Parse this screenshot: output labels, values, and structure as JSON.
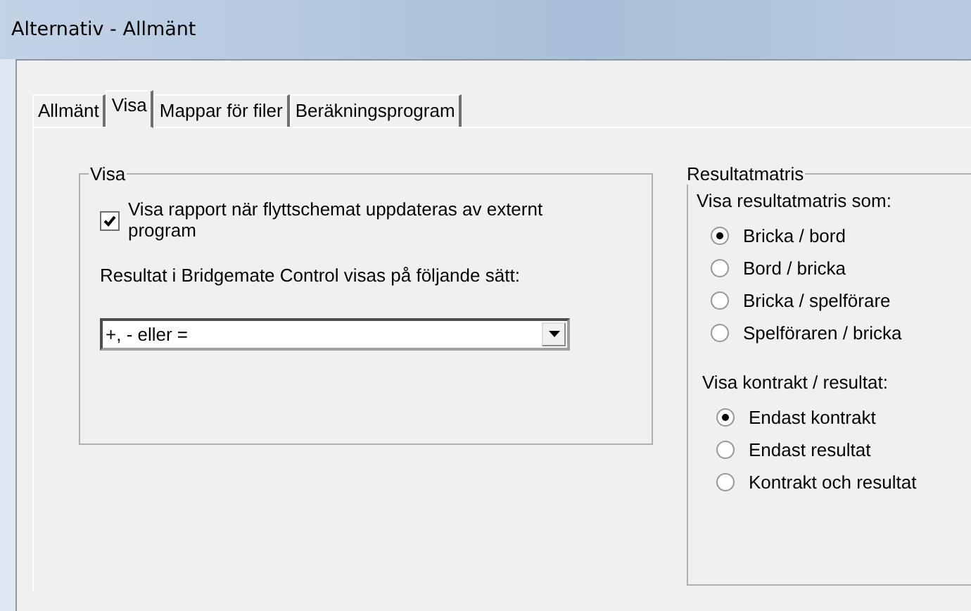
{
  "window": {
    "title": "Alternativ - Allmänt"
  },
  "tabs": [
    {
      "label": "Allmänt",
      "selected": false
    },
    {
      "label": "Visa",
      "selected": true
    },
    {
      "label": "Mappar för filer",
      "selected": false
    },
    {
      "label": "Beräkningsprogram",
      "selected": false
    }
  ],
  "visa_group": {
    "title": "Visa",
    "checkbox": {
      "label": "Visa rapport när flyttschemat uppdateras av externt program",
      "checked": true
    },
    "dropdown_label": "Resultat i Bridgemate Control visas på följande sätt:",
    "dropdown": {
      "value": "+, - eller ="
    }
  },
  "matrix_group": {
    "title": "Resultatmatris",
    "sections": [
      {
        "label": "Visa resultatmatris som:",
        "options": [
          {
            "label": "Bricka / bord",
            "selected": true
          },
          {
            "label": "Bord / bricka",
            "selected": false
          },
          {
            "label": "Bricka / spelförare",
            "selected": false
          },
          {
            "label": "Spelföraren / bricka",
            "selected": false
          }
        ]
      },
      {
        "label": "Visa kontrakt / resultat:",
        "options": [
          {
            "label": "Endast kontrakt",
            "selected": true
          },
          {
            "label": "Endast resultat",
            "selected": false
          },
          {
            "label": "Kontrakt och resultat",
            "selected": false
          }
        ]
      }
    ]
  }
}
